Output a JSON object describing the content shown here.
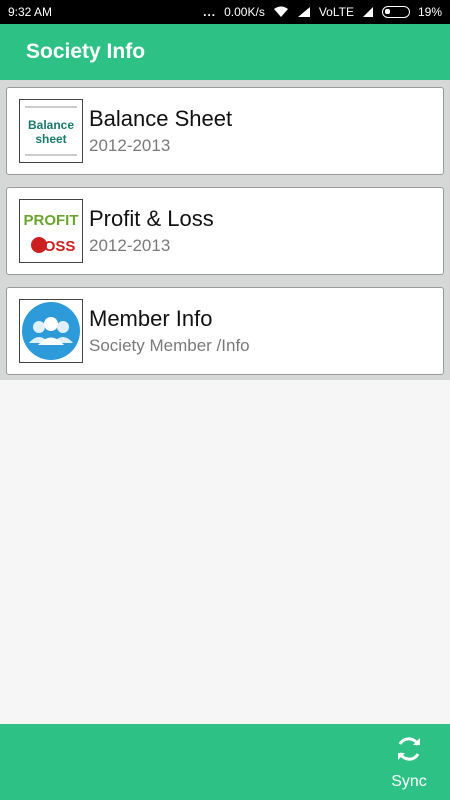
{
  "status_bar": {
    "time": "9:32 AM",
    "dots": "...",
    "speed": "0.00K/s",
    "volte": "VoLTE",
    "battery": "19%"
  },
  "app_bar": {
    "title": "Society Info"
  },
  "items": [
    {
      "title": "Balance Sheet",
      "subtitle": "2012-2013",
      "icon": "balance-sheet-image",
      "thumb_text": "Balance sheet"
    },
    {
      "title": "Profit & Loss",
      "subtitle": "2012-2013",
      "icon": "profit-loss-image",
      "thumb_top": "PROFIT",
      "thumb_bottom": "LOSS"
    },
    {
      "title": "Member Info",
      "subtitle": "Society Member /Info",
      "icon": "members-icon"
    }
  ],
  "bottom_bar": {
    "sync_label": "Sync",
    "sync_icon": "sync-icon"
  },
  "colors": {
    "accent": "#2ec185",
    "list_bg": "#d6d8d8",
    "member_icon": "#2d9bd9"
  }
}
